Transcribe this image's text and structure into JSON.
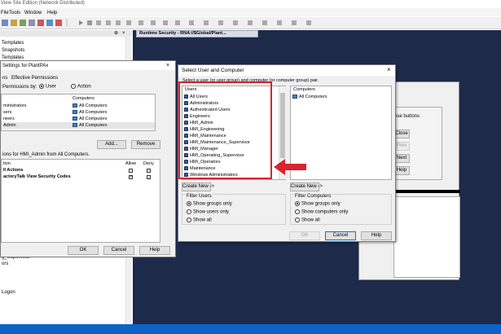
{
  "app": {
    "title": "View Site Edition (Network Distributed)",
    "menu": [
      "File",
      "Tools",
      "Window",
      "Help"
    ],
    "tab_title": "Runtime Security - RNA://$Global/Plant..."
  },
  "explorer": {
    "top_items": [
      "Templates",
      "Snapshots",
      "Templates"
    ],
    "bottom_items": [
      "g_Supervisor",
      "ors",
      "Logon"
    ]
  },
  "settings_dialog": {
    "title": "Settings for PlantPAx",
    "tabs": [
      "ns",
      "Effective Permissions"
    ],
    "permissions_by_label": "Permissions by:",
    "radio_user": "User",
    "radio_action": "Action",
    "computers_header": "Computers",
    "rows": [
      {
        "user": "ministrators",
        "computer": "All Computers"
      },
      {
        "user": "sers",
        "computer": "All Computers"
      },
      {
        "user": "neers",
        "computer": "All Computers"
      },
      {
        "user": "Admin",
        "computer": "All Computers"
      }
    ],
    "add_button": "Add...",
    "remove_button": "Remove",
    "perm_caption": "ions for HMI_Admin from All Computers.",
    "col_action": "tion",
    "col_allow": "Allow",
    "col_deny": "Deny",
    "perm_rows": [
      {
        "label": "ll Actions",
        "allow": false,
        "deny": false
      },
      {
        "label": "actoryTalk View Security Codes",
        "allow": true,
        "deny": false
      }
    ],
    "ok": "OK",
    "cancel": "Cancel",
    "help": "Help"
  },
  "select_dialog": {
    "title": "Select User and Computer",
    "instruction": "Select a user (or user group) and computer (or computer group) pair.",
    "users_header": "Users",
    "users": [
      "All Users",
      "Administrators",
      "Authenticated Users",
      "Engineers",
      "HMI_Admin",
      "HMI_Engineering",
      "HMI_Maintenance",
      "HMI_Maintenance_Supervisor",
      "HMI_Manager",
      "HMI_Operating_Supervisor",
      "HMI_Operators",
      "Maintenance",
      "Windows Administrators"
    ],
    "computers_header": "Computers",
    "computers": [
      "All Computers"
    ],
    "create_new_users": "Create New ->",
    "create_new_computers": "Create New ->",
    "filter_users_label": "Filter Users",
    "filter_users_options": [
      "Show groups only",
      "Show users only",
      "Show all"
    ],
    "filter_computers_label": "Filter Computers",
    "filter_computers_options": [
      "Show groups only",
      "Show computers only",
      "Show all"
    ],
    "ok": "OK",
    "cancel": "Cancel",
    "help": "Help"
  },
  "background_panel": {
    "caption": "ese buttons",
    "buttons": [
      "Close",
      "Prev",
      "Next",
      "Help"
    ]
  },
  "colors": {
    "highlight_red": "#d9232e",
    "dark_bg": "#1e2a4a",
    "taskbar": "#0a64c8"
  }
}
